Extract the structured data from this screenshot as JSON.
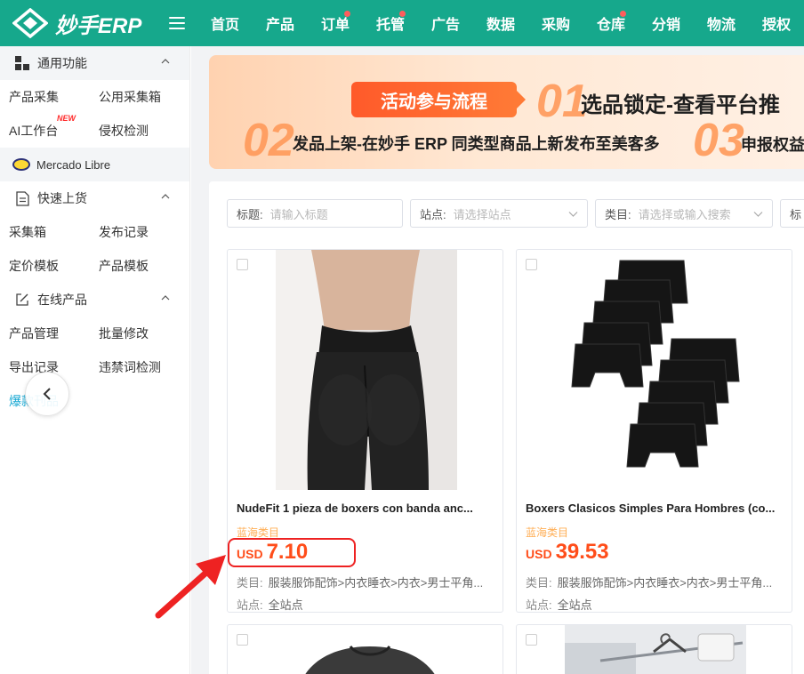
{
  "brand": {
    "name": "妙手ERP"
  },
  "nav": [
    {
      "label": "首页",
      "dot": false
    },
    {
      "label": "产品",
      "dot": false
    },
    {
      "label": "订单",
      "dot": true
    },
    {
      "label": "托管",
      "dot": true
    },
    {
      "label": "广告",
      "dot": false
    },
    {
      "label": "数据",
      "dot": false
    },
    {
      "label": "采购",
      "dot": false
    },
    {
      "label": "仓库",
      "dot": true
    },
    {
      "label": "分销",
      "dot": false
    },
    {
      "label": "物流",
      "dot": false
    },
    {
      "label": "授权",
      "dot": false
    }
  ],
  "sidebar": {
    "general": {
      "title": "通用功能",
      "rows": [
        [
          "产品采集",
          "公用采集箱"
        ],
        [
          "AI工作台",
          "侵权检测"
        ]
      ],
      "new_badge": "NEW"
    },
    "platform": "Mercado Libre",
    "quick": {
      "title": "快速上货",
      "rows": [
        [
          "采集箱",
          "发布记录"
        ],
        [
          "定价模板",
          "产品模板"
        ]
      ]
    },
    "online": {
      "title": "在线产品",
      "rows": [
        [
          "产品管理",
          "批量修改"
        ],
        [
          "导出记录",
          "违禁词检测"
        ]
      ]
    },
    "hot": "爆款刊品"
  },
  "banner": {
    "button": "活动参与流程",
    "num1": "01",
    "step1": "选品锁定-查看平台推",
    "num2": "02",
    "step2": "发品上架-在妙手 ERP 同类型商品上新发布至美客多",
    "num3": "03",
    "step3": "申报权益-..."
  },
  "filters": [
    {
      "label": "标题:",
      "placeholder": "请输入标题",
      "dropdown": false
    },
    {
      "label": "站点:",
      "placeholder": "请选择站点",
      "dropdown": true
    },
    {
      "label": "类目:",
      "placeholder": "请选择或输入搜索",
      "dropdown": true
    },
    {
      "label": "标",
      "placeholder": "",
      "dropdown": false
    }
  ],
  "products": [
    {
      "title": "NudeFit 1 pieza de boxers con banda anc...",
      "tag": "蓝海类目",
      "currency": "USD",
      "price": "7.10",
      "category_label": "类目:",
      "category": "服装服饰配饰>内衣睡衣>内衣>男士平角...",
      "site_label": "站点:",
      "site": "全站点"
    },
    {
      "title": "Boxers Clasicos Simples Para Hombres (co...",
      "tag": "蓝海类目",
      "currency": "USD",
      "price": "39.53",
      "category_label": "类目:",
      "category": "服装服饰配饰>内衣睡衣>内衣>男士平角...",
      "site_label": "站点:",
      "site": "全站点"
    }
  ],
  "colors": {
    "header": "#16a88c",
    "price": "#ff4d1a",
    "tag": "#ffae55",
    "highlight": "#ee2222"
  }
}
